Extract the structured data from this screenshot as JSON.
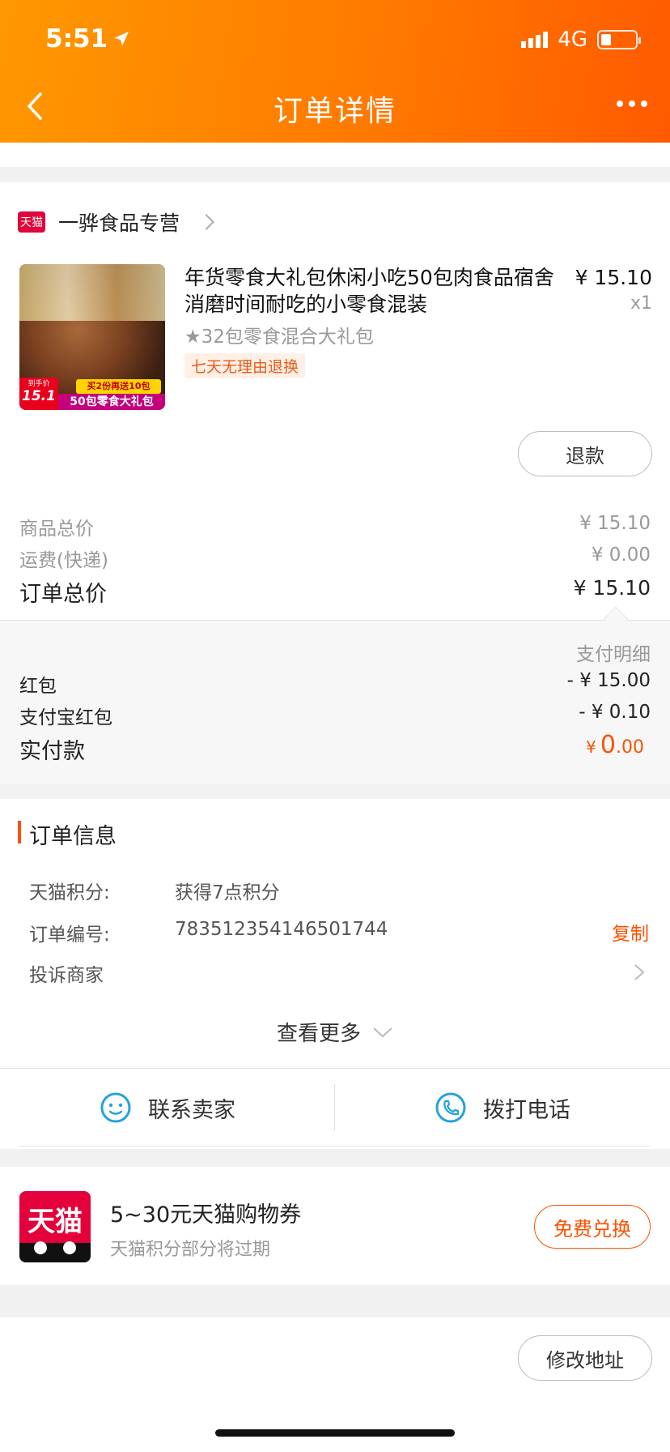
{
  "status_bar": {
    "time": "5:51",
    "network": "4G"
  },
  "header": {
    "title": "订单详情"
  },
  "shop": {
    "badge": "天猫",
    "name": "一骅食品专营"
  },
  "product": {
    "title": "年货零食大礼包休闲小吃50包肉食品宿舍消磨时间耐吃的小零食混装",
    "price": "¥ 15.10",
    "quantity": "x1",
    "sku": "★32包零食混合大礼包",
    "return_tag": "七天无理由退换",
    "image_banner_top": "买2份再送10包",
    "image_banner_main": "50包零食大礼包",
    "image_price_label": "到手价",
    "image_price": "15.1"
  },
  "refund_button": "退款",
  "totals": {
    "goods_label": "商品总价",
    "goods_value": "¥ 15.10",
    "shipping_label": "运费(快递)",
    "shipping_value": "¥ 0.00",
    "order_label": "订单总价",
    "order_value": "¥ 15.10"
  },
  "payment": {
    "detail_label": "支付明细",
    "hongbao_label": "红包",
    "hongbao_value": "- ¥ 15.00",
    "alipay_label": "支付宝红包",
    "alipay_value": "- ¥ 0.10",
    "paid_label": "实付款",
    "paid_currency": "¥",
    "paid_int": "0",
    "paid_dec": ".00",
    "accent_color": "#ff5000"
  },
  "order_info": {
    "title": "订单信息",
    "points_label": "天猫积分:",
    "points_value": "获得7点积分",
    "order_no_label": "订单编号:",
    "order_no_value": "783512354146501744",
    "copy_label": "复制",
    "complaint_label": "投诉商家",
    "see_more": "查看更多"
  },
  "contact": {
    "seller_label": "联系卖家",
    "phone_label": "拨打电话"
  },
  "coupon": {
    "logo_text": "天猫",
    "title": "5~30元天猫购物券",
    "subtitle": "天猫积分部分将过期",
    "button": "免费兑换"
  },
  "address_button": "修改地址"
}
